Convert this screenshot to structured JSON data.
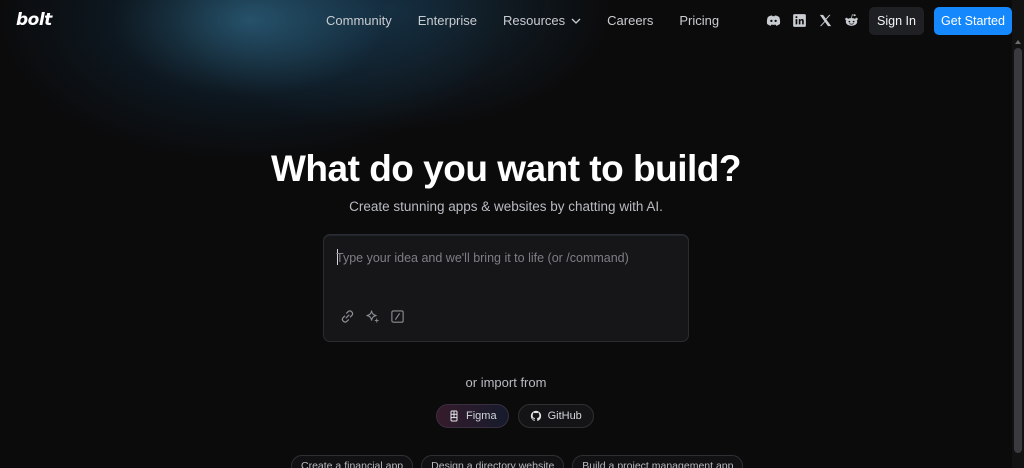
{
  "header": {
    "logo": "bolt",
    "nav": [
      {
        "label": "Community"
      },
      {
        "label": "Enterprise"
      },
      {
        "label": "Resources",
        "dropdown": true
      },
      {
        "label": "Careers"
      },
      {
        "label": "Pricing"
      }
    ],
    "social_icons": [
      "discord-icon",
      "linkedin-icon",
      "x-icon",
      "reddit-icon"
    ],
    "sign_in_label": "Sign In",
    "get_started_label": "Get Started"
  },
  "hero": {
    "title": "What do you want to build?",
    "subtitle": "Create stunning apps & websites by chatting with AI."
  },
  "prompt": {
    "placeholder": "Type your idea and we'll bring it to life (or /command)",
    "value": "",
    "tools": [
      "link-icon",
      "sparkle-icon",
      "command-icon"
    ]
  },
  "import": {
    "label": "or import from",
    "sources": [
      {
        "label": "Figma",
        "icon": "figma-icon"
      },
      {
        "label": "GitHub",
        "icon": "github-icon"
      }
    ]
  },
  "suggestions": [
    "Create a financial app",
    "Design a directory website",
    "Build a project management app"
  ],
  "colors": {
    "background": "#0b0b0c",
    "accent": "#1488fc",
    "prompt_bg": "#161618"
  }
}
